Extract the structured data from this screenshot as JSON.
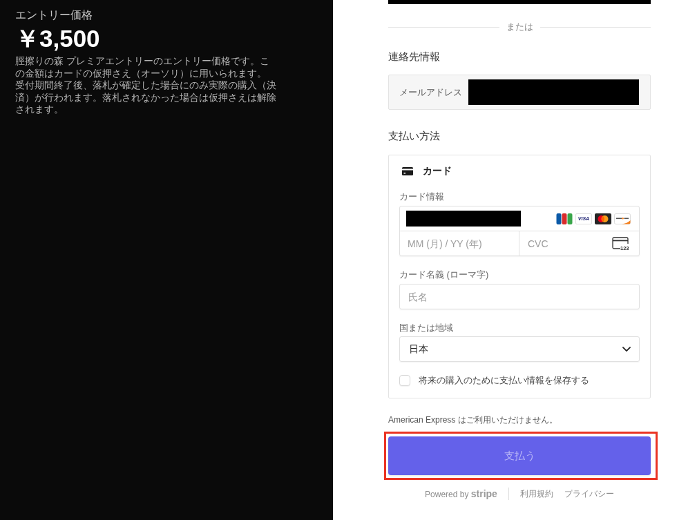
{
  "summary": {
    "label": "エントリー価格",
    "price": "￥3,500",
    "description": [
      "脛擦りの森 プレミアエントリーのエントリー価格です。この金額はカードの仮押さえ（オーソリ）に用いられます。",
      "受付期間終了後、落札が確定した場合にのみ実際の購入（決済）が行われます。落札されなかった場合は仮押さえは解除されます。"
    ]
  },
  "checkout": {
    "top_block": {
      "redacted": true
    },
    "divider_text": "または",
    "contact": {
      "heading": "連絡先情報",
      "email": {
        "label": "メールアドレス",
        "redacted": true
      }
    },
    "payment": {
      "heading": "支払い方法",
      "method": {
        "label": "カード"
      },
      "card_info": {
        "label": "カード情報",
        "number": {
          "redacted": true
        },
        "brands": [
          {
            "kind": "jcb"
          },
          {
            "kind": "visa",
            "label": "VISA"
          },
          {
            "kind": "mastercard"
          },
          {
            "kind": "discover"
          }
        ],
        "expiry": {
          "placeholder": "MM (月) / YY (年)"
        },
        "cvc": {
          "placeholder": "CVC",
          "icon_text": "123"
        }
      },
      "cardholder": {
        "label": "カード名義 (ローマ字)",
        "placeholder": "氏名"
      },
      "country": {
        "label": "国または地域",
        "value": "日本"
      },
      "save_info": {
        "label": "将来の購入のために支払い情報を保存する",
        "checked": false
      }
    },
    "notice": "American Express はご利用いただけません。",
    "pay_button": {
      "label": "支払う",
      "disabled": true,
      "highlighted": true
    },
    "footer": {
      "powered_by": "Powered by **stripe**",
      "links": [
        "利用規約",
        "プライバシー"
      ]
    }
  }
}
